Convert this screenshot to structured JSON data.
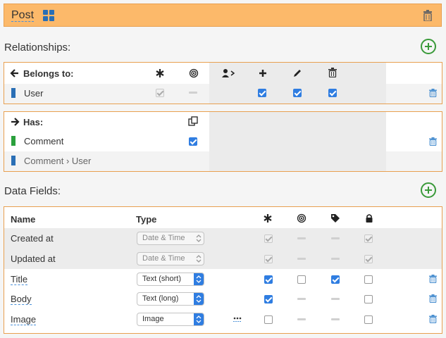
{
  "header": {
    "title": "Post"
  },
  "relationships": {
    "section_title": "Relationships:",
    "belongs_to": {
      "label": "Belongs to:",
      "rows": [
        {
          "name": "User",
          "color": "#2a6fb5"
        }
      ]
    },
    "has": {
      "label": "Has:",
      "rows": [
        {
          "name": "Comment",
          "color": "#2aa03c"
        },
        {
          "name": "Comment › User",
          "color": "#2a6fb5"
        }
      ]
    }
  },
  "data_fields": {
    "section_title": "Data Fields:",
    "col_name": "Name",
    "col_type": "Type",
    "rows": [
      {
        "name": "Created at",
        "type": "Date & Time"
      },
      {
        "name": "Updated at",
        "type": "Date & Time"
      },
      {
        "name": "Title",
        "type": "Text (short)"
      },
      {
        "name": "Body",
        "type": "Text (long)"
      },
      {
        "name": "Image",
        "type": "Image"
      }
    ]
  },
  "colors": {
    "accent": "#fcb96a",
    "border": "#e8a050",
    "checkbox": "#2f7de1",
    "add": "#3a9a3a"
  },
  "icons": [
    "grid-icon",
    "trash-icon",
    "plus-circle-icon",
    "asterisk-icon",
    "target-icon",
    "user-arrow-icon",
    "plus-icon",
    "pencil-icon",
    "copy-icon",
    "tag-icon",
    "lock-icon",
    "ellipsis-icon",
    "arrow-left-icon",
    "arrow-right-icon"
  ]
}
